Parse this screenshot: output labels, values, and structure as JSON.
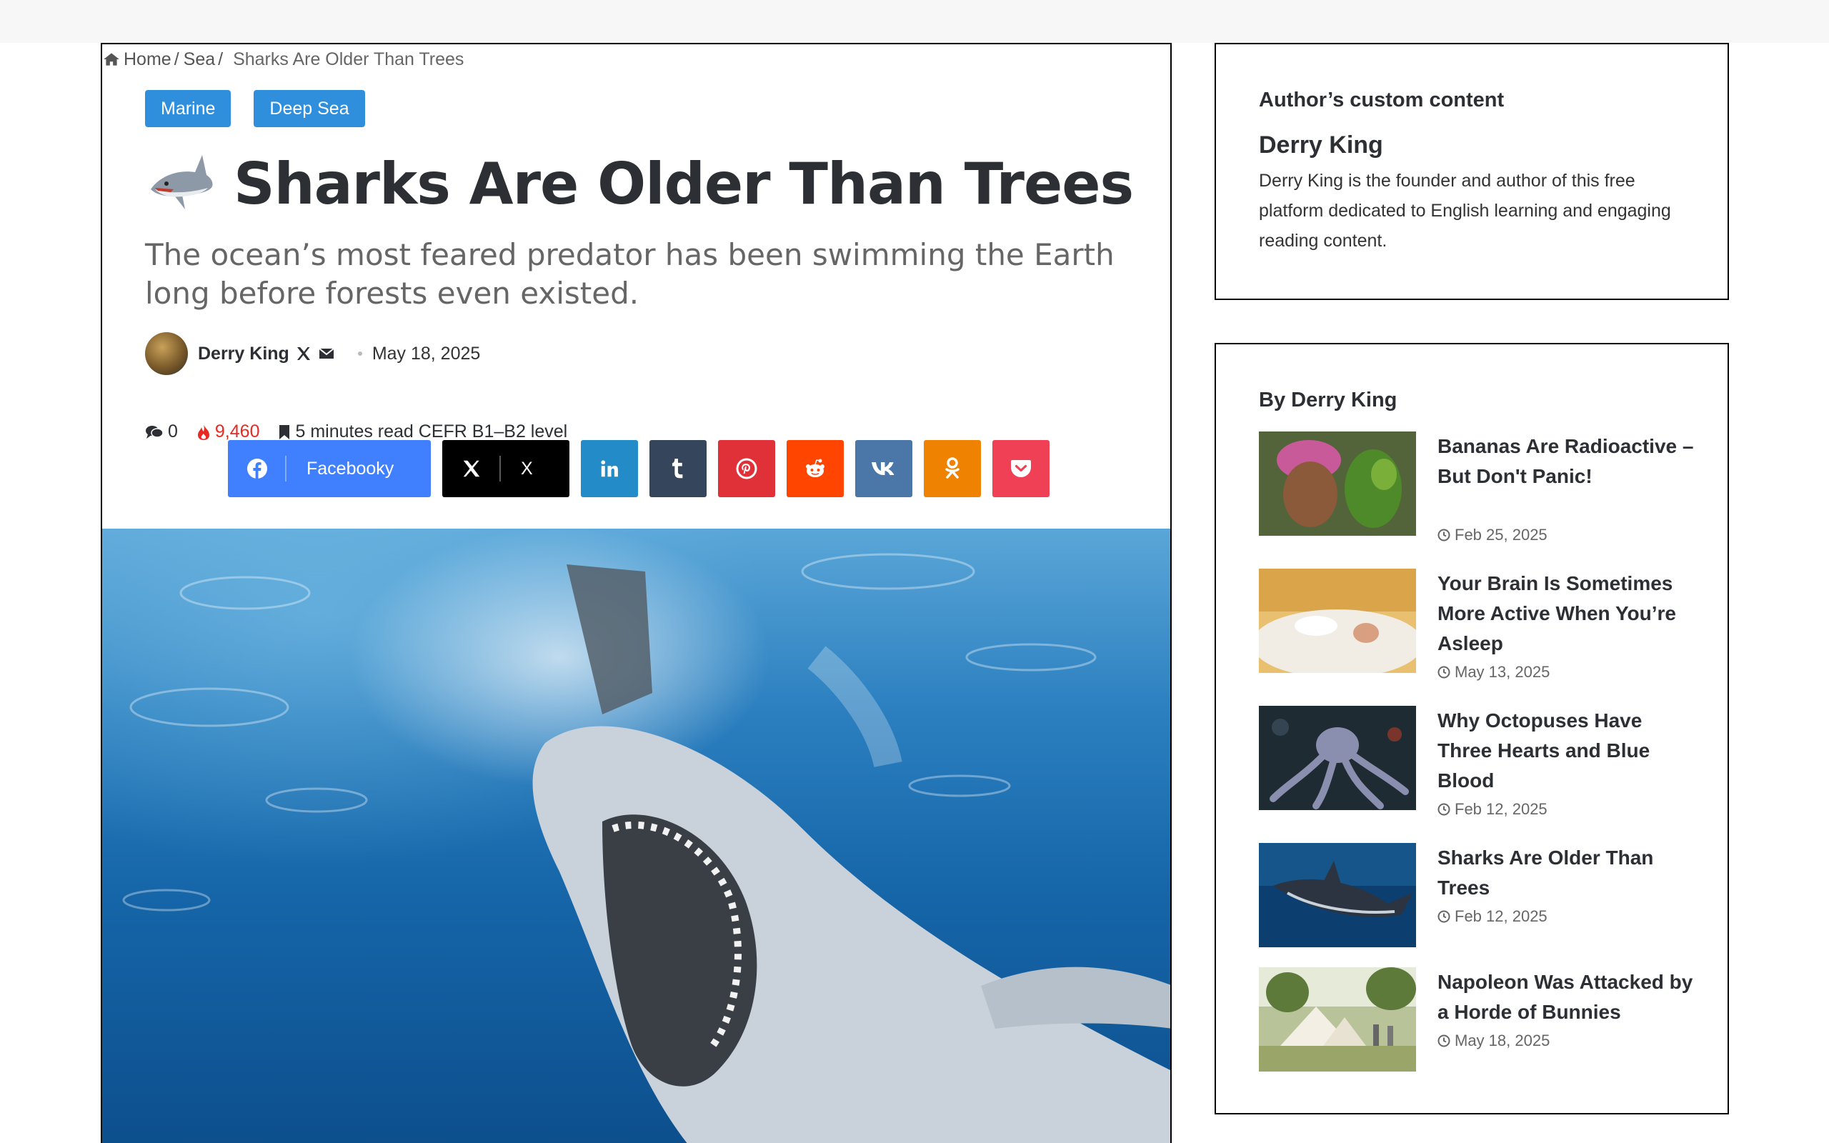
{
  "breadcrumb": {
    "home": "Home",
    "sep": "/",
    "section": "Sea",
    "current": "Sharks Are Older Than Trees"
  },
  "categories": [
    "Marine",
    "Deep Sea"
  ],
  "article": {
    "title": "Sharks Are Older Than Trees",
    "title_icon": "shark-emoji-icon",
    "subtitle": "The ocean’s most feared predator has been swimming the Earth long before forests even existed.",
    "author": "Derry King",
    "date": "May 18, 2025",
    "comments": "0",
    "views": "9,460",
    "read_time": "5 minutes read CEFR B1–B2 level"
  },
  "share": {
    "facebook_label": "Facebooky",
    "x_label": "X",
    "buttons": [
      "facebook",
      "x",
      "linkedin",
      "tumblr",
      "pinterest",
      "reddit",
      "vk",
      "odnoklassniki",
      "pocket"
    ]
  },
  "colors": {
    "accent": "#2f8fdc",
    "facebook": "#4080ff",
    "x": "#000000",
    "linkedin": "#238cc8",
    "tumblr": "#35465c",
    "pinterest": "#e13138",
    "reddit": "#ff4500",
    "vk": "#4a76a8",
    "odnoklassniki": "#ef8200",
    "pocket": "#ef4056",
    "views": "#e52b24"
  },
  "sidebar_author": {
    "title": "Author’s custom content",
    "name": "Derry King",
    "bio": "Derry King is the founder and author of this free platform dedicated to English learning and engaging reading content."
  },
  "sidebar_posts": {
    "title": "By Derry King",
    "items": [
      {
        "title": "Bananas Are Radioactive – But Don't Panic!",
        "date": "Feb 25, 2025"
      },
      {
        "title": "Your Brain Is Sometimes More Active When You’re Asleep",
        "date": "May 13, 2025"
      },
      {
        "title": "Why Octopuses Have Three Hearts and Blue Blood",
        "date": "Feb 12, 2025"
      },
      {
        "title": "Sharks Are Older Than Trees",
        "date": "Feb 12, 2025"
      },
      {
        "title": "Napoleon Was Attacked by a Horde of Bunnies",
        "date": "May 18, 2025"
      }
    ]
  }
}
